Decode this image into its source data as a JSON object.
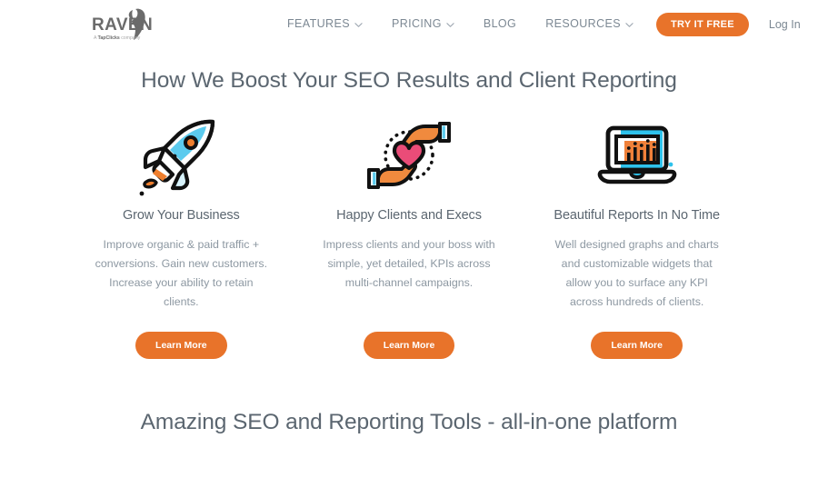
{
  "header": {
    "logo": {
      "name": "RAVEN",
      "tagline_prefix": "A",
      "tagline_brand": "TapClicks",
      "tagline_suffix": "company"
    },
    "nav": [
      {
        "label": "FEATURES",
        "icon": "chevron-down-icon",
        "has_dropdown": true
      },
      {
        "label": "PRICING",
        "icon": "chevron-down-icon",
        "has_dropdown": true
      },
      {
        "label": "BLOG",
        "icon": "",
        "has_dropdown": false
      },
      {
        "label": "RESOURCES",
        "icon": "chevron-down-icon",
        "has_dropdown": true
      }
    ],
    "cta_label": "TRY IT FREE",
    "login_label": "Log In"
  },
  "main": {
    "section_title": "How We Boost Your SEO Results and Client Reporting",
    "columns": [
      {
        "icon": "rocket-icon",
        "title": "Grow Your Business",
        "text": "Improve organic & paid traffic + conversions. Gain new customers. Increase your ability to retain clients.",
        "button_label": "Learn More"
      },
      {
        "icon": "hands-heart-icon",
        "title": "Happy Clients and Execs",
        "text": "Impress clients and your boss with simple, yet detailed, KPIs across multi-channel campaigns.",
        "button_label": "Learn More"
      },
      {
        "icon": "laptop-chart-icon",
        "title": "Beautiful Reports In No Time",
        "text": "Well designed graphs and charts and customizable widgets that allow you to surface any KPI across hundreds of clients.",
        "button_label": "Learn More"
      }
    ],
    "bottom_title": "Amazing SEO and Reporting Tools - all-in-one platform"
  },
  "colors": {
    "accent_orange": "#e8732a",
    "heading_gray": "#5b6670",
    "body_gray": "#8d98a2",
    "nav_gray": "#7c8893",
    "icon_cyan": "#4cc9ea",
    "icon_pink": "#ea4c78",
    "icon_outline": "#1a1a1a",
    "logo_gray": "#6b6b6b"
  }
}
